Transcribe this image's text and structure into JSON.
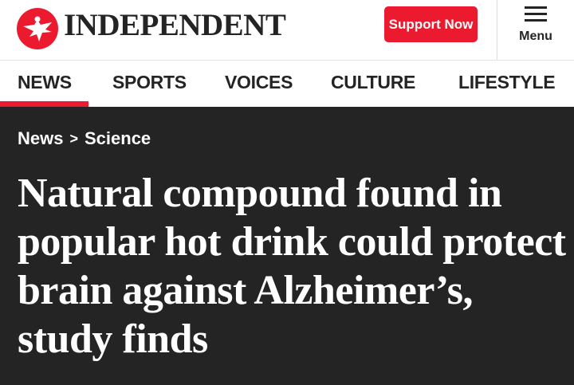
{
  "header": {
    "logo_text": "INDEPENDENT",
    "logo_icon": "eagle-icon",
    "support_label": "Support Now",
    "menu_label": "Menu",
    "menu_icon": "hamburger-icon"
  },
  "nav": {
    "items": [
      {
        "label": "NEWS",
        "active": true
      },
      {
        "label": "SPORTS",
        "active": false
      },
      {
        "label": "VOICES",
        "active": false
      },
      {
        "label": "CULTURE",
        "active": false
      },
      {
        "label": "LIFESTYLE",
        "active": false
      }
    ]
  },
  "article": {
    "breadcrumb": {
      "section": "News",
      "separator": ">",
      "subsection": "Science"
    },
    "headline": "Natural compound found in popular hot drink could protect brain against Alzheimer’s, study finds"
  },
  "colors": {
    "brand_red": "#ec1a2e",
    "dark_background": "#242424",
    "text_dark": "#242424",
    "text_light": "#ffffff"
  }
}
